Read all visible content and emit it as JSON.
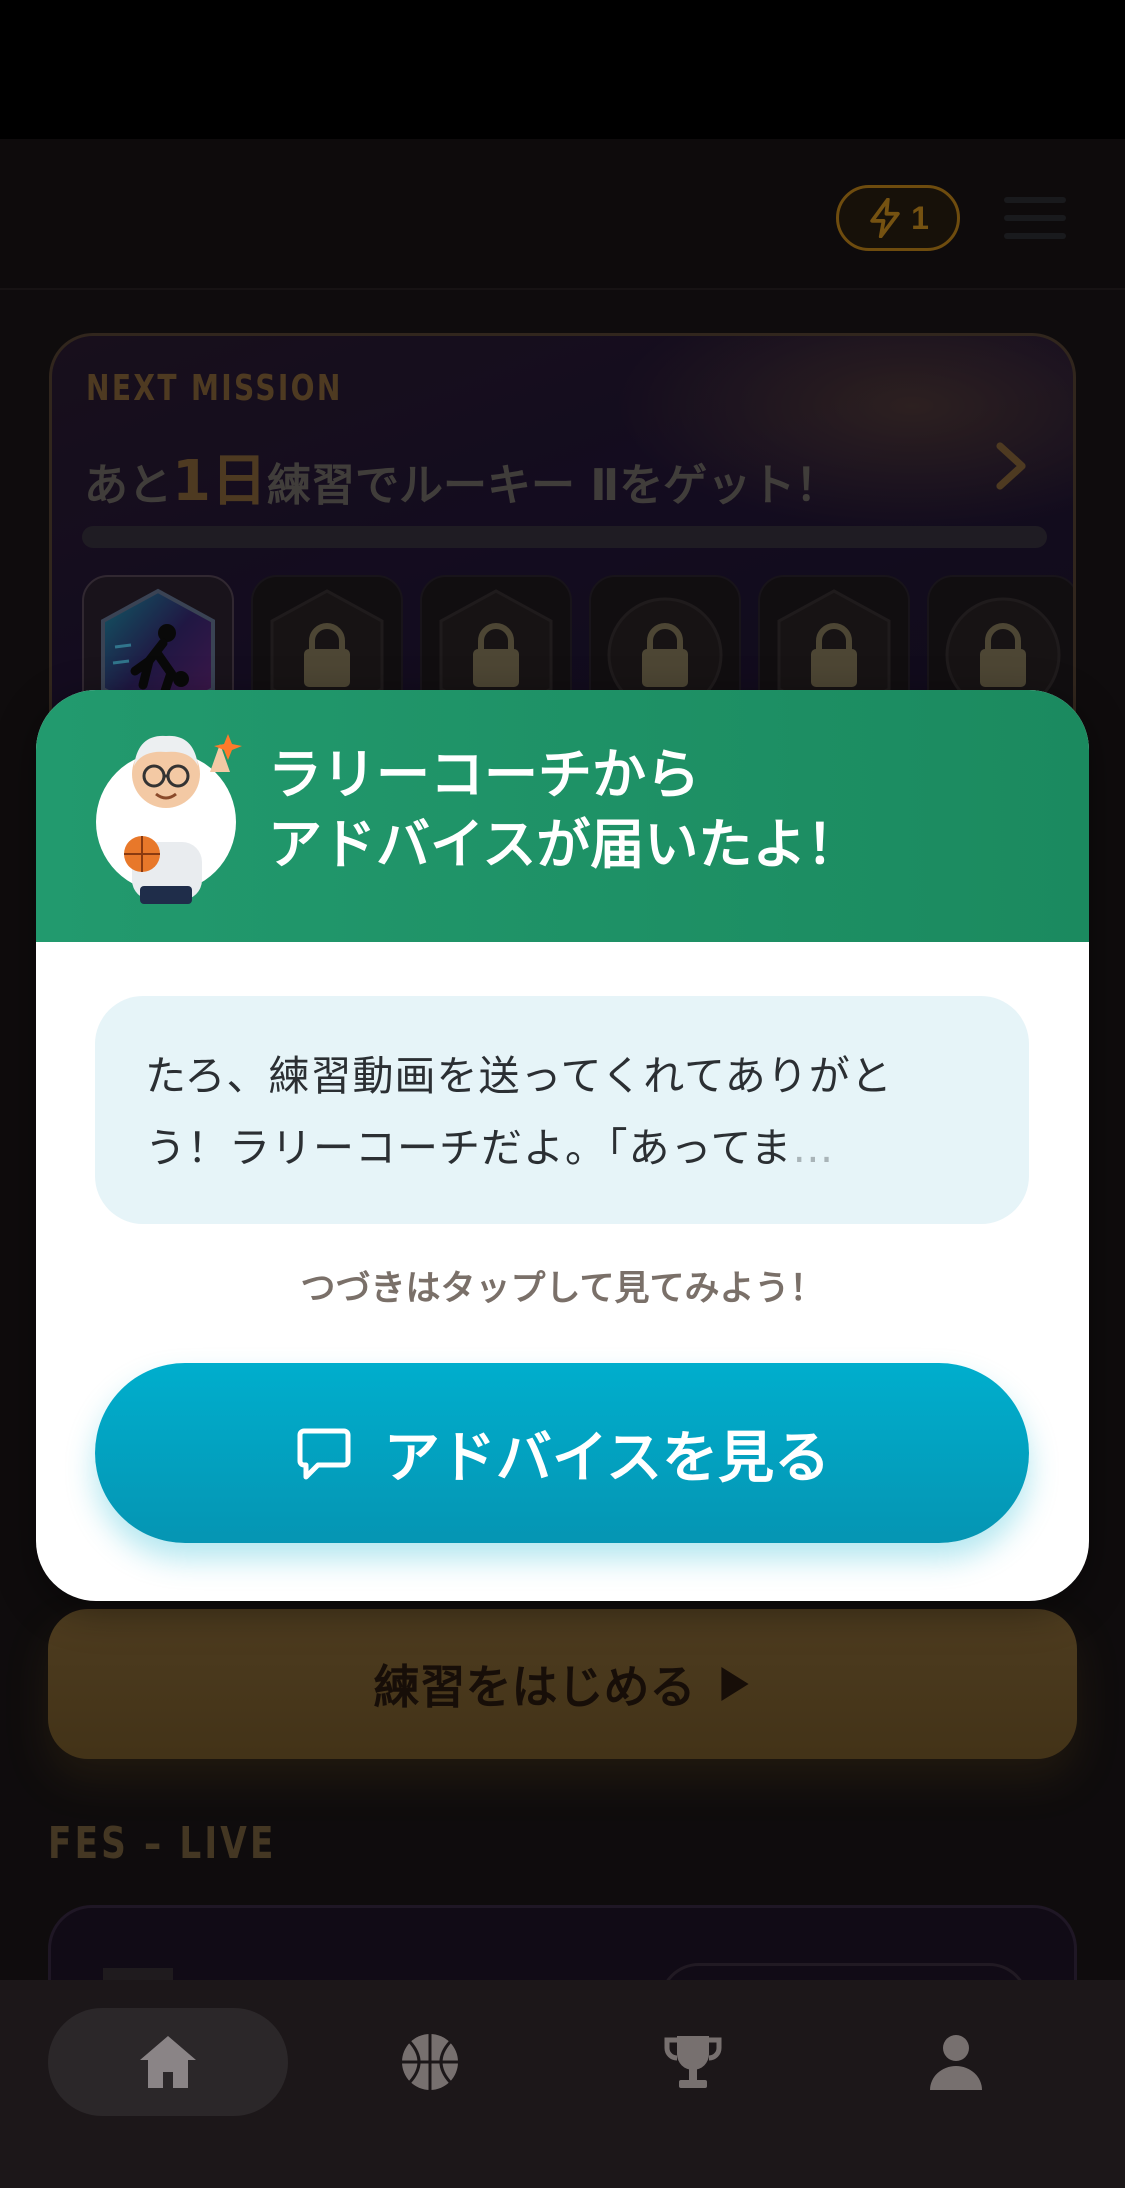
{
  "header": {
    "energy_count": "1"
  },
  "mission": {
    "eyebrow": "NEXT MISSION",
    "title_prefix": "あと",
    "title_number": "1日",
    "title_suffix": "練習でルーキー Ⅱをゲット！",
    "progress_fraction": 0.0,
    "badges_total": 6,
    "badges_unlocked": 1
  },
  "modal": {
    "title_line1": "ラリーコーチから",
    "title_line2": "アドバイスが届いたよ！",
    "message_line1": "たろ、練習動画を送ってくれてありがと",
    "message_line2": "う！ラリーコーチだよ。「あってま",
    "message_ellipsis": "…",
    "hint": "つづきはタップして見てみよう！",
    "button_label": "アドバイスを見る"
  },
  "main": {
    "start_button_label": "練習をはじめる",
    "fes_label": "FES – LIVE"
  },
  "tabbar": {
    "items": [
      "home-icon",
      "basketball-icon",
      "trophy-icon",
      "user-icon"
    ],
    "active": "home"
  },
  "colors": {
    "accent_gold": "#8e6a3d",
    "modal_header_green": "#229a6e",
    "advice_button_cyan": "#00aecd",
    "energy_orange": "#d6951f"
  }
}
